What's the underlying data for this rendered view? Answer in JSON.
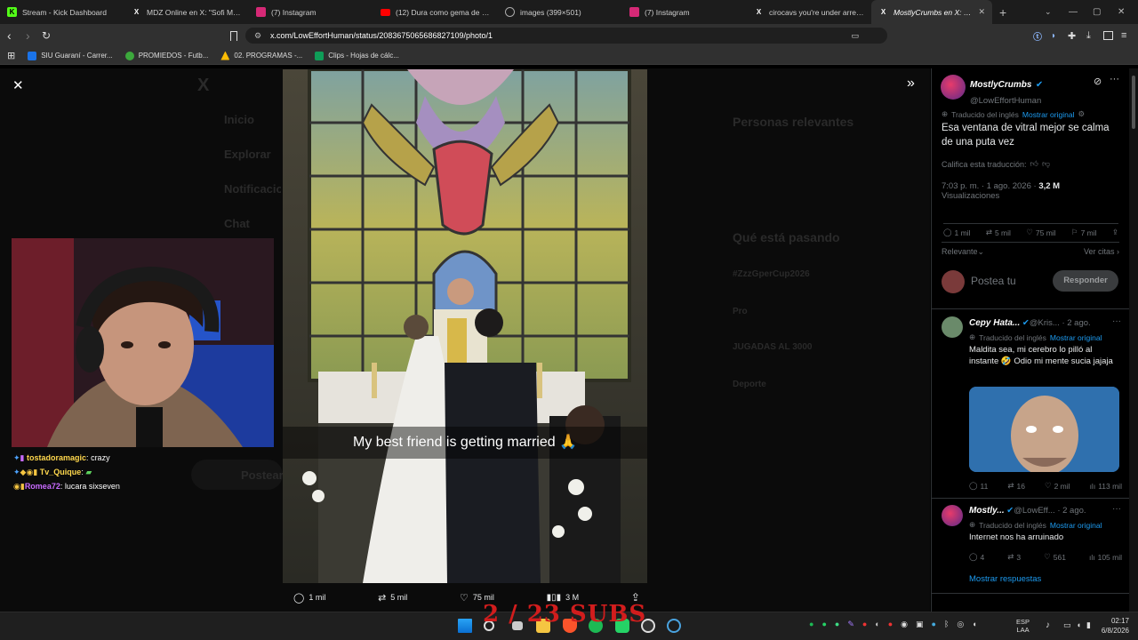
{
  "tabs": [
    {
      "title": "Stream - Kick Dashboard",
      "icon": "kick-icon",
      "color": "#53fc18"
    },
    {
      "title": "MDZ Online en X: \"Sofi Maure",
      "icon": "x-icon",
      "color": "#fff"
    },
    {
      "title": "(7) Instagram",
      "icon": "instagram-icon",
      "color": "#e1306c"
    },
    {
      "title": "(12) Dura como gema de dian",
      "icon": "youtube-icon",
      "color": "#ff0000"
    },
    {
      "title": "images (399×501)",
      "icon": "globe-icon",
      "color": "#aaa"
    },
    {
      "title": "(7) Instagram",
      "icon": "instagram-icon",
      "color": "#e1306c"
    },
    {
      "title": "cirocavs you're under arrest fo",
      "icon": "x-icon",
      "color": "#fff"
    },
    {
      "title": "MostlyCrumbs en X: \"Th",
      "icon": "x-icon",
      "color": "#fff",
      "active": true
    }
  ],
  "url": "x.com/LowEffortHuman/status/2083675065686827109/photo/1",
  "bookmarks": [
    {
      "label": "SIU Guaraní - Carrer...",
      "color": "#1a73e8"
    },
    {
      "label": "PROMIEDOS - Futb...",
      "color": "#3ca83c"
    },
    {
      "label": "02. PROGRAMAS -...",
      "color": "#fbbc04"
    },
    {
      "label": "Clips - Hojas de cálc...",
      "color": "#0f9d58"
    }
  ],
  "ghost_nav": [
    "Inicio",
    "Explorar",
    "Notificaciones",
    "Chat",
    "Postear"
  ],
  "ghost_right": {
    "heading": "Personas relevantes",
    "trend": "Qué está pasando",
    "items": [
      "#ZzzGperCup2026",
      "Pro",
      "JUGADAS AL 3000",
      "Deporte"
    ]
  },
  "photo": {
    "caption": "My best friend is getting married 🙏"
  },
  "photo_actions": {
    "replies": "1 mil",
    "reposts": "5 mil",
    "likes": "75 mil",
    "views": "3 M"
  },
  "chat": [
    {
      "user": "tostadoramagic",
      "msg": "crazy",
      "color": "#ffd84d"
    },
    {
      "user": "Tv_Quique",
      "msg": "",
      "color": "#ffd84d"
    },
    {
      "user": "Romea72",
      "msg": "lucara sixseven",
      "color": "#c86bff"
    }
  ],
  "tweet": {
    "name": "MostlyCrumbs",
    "handle": "@LowEffortHuman",
    "translated_label": "Traducido del inglés",
    "show_original": "Mostrar original",
    "text": "Esa ventana de vitral mejor se calma de una puta vez",
    "rate": "Califica esta traducción:",
    "time": "7:03 p. m. · 1 ago. 2026 ·",
    "views_count": "3,2 M",
    "views_label": "Visualizaciones",
    "stats": {
      "replies": "1 mil",
      "reposts": "5 mil",
      "likes": "75 mil",
      "bookmarks": "7 mil"
    },
    "sort": "Relevante",
    "quotes": "Ver citas",
    "reply_placeholder": "Postea tu",
    "reply_button": "Responder"
  },
  "replies": [
    {
      "name": "Cepy Hata...",
      "handle": "@Kris...",
      "time": "· 2 ago.",
      "translated": "Traducido del inglés",
      "show": "Mostrar original",
      "text": "Maldita sea, mi cerebro lo pilló al instante 🤣 Odio mi mente sucia jajaja",
      "stats": {
        "replies": "11",
        "reposts": "16",
        "likes": "2 mil",
        "views": "113 mil"
      }
    },
    {
      "name": "Mostly...",
      "handle": "@LowEff...",
      "time": "· 2 ago.",
      "translated": "Traducido del inglés",
      "show": "Mostrar original",
      "text": "Internet nos ha arruinado",
      "stats": {
        "replies": "4",
        "reposts": "3",
        "likes": "561",
        "views": "105 mil"
      }
    }
  ],
  "show_replies": "Mostrar respuestas",
  "overlay": "2 / 23 SUBS",
  "clock": {
    "time": "02:17",
    "date": "6/8/2026",
    "lang": "ESP",
    "layout": "LAA"
  }
}
